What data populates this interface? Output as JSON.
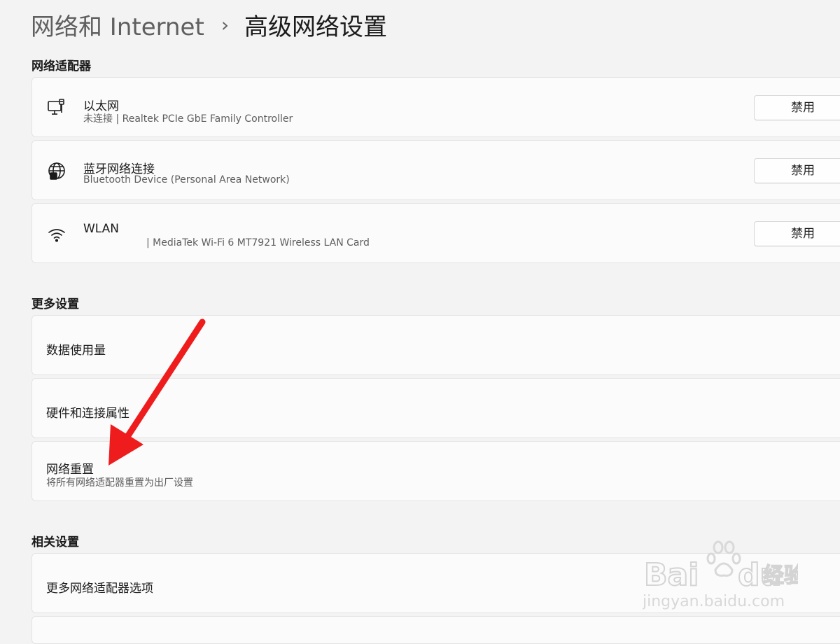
{
  "breadcrumb": {
    "parent": "网络和 Internet",
    "separator": "›",
    "current": "高级网络设置"
  },
  "sections": {
    "adapters": "网络适配器",
    "more": "更多设置",
    "related": "相关设置"
  },
  "adapters": [
    {
      "icon": "ethernet-monitor-icon",
      "name": "以太网",
      "detail": "未连接 | Realtek PCIe GbE Family Controller",
      "button": "禁用"
    },
    {
      "icon": "bluetooth-network-globe-icon",
      "name": "蓝牙网络连接",
      "detail": "Bluetooth Device (Personal Area Network)",
      "button": "禁用"
    },
    {
      "icon": "wifi-icon",
      "name": "WLAN",
      "detail": "| MediaTek Wi-Fi 6 MT7921 Wireless LAN Card",
      "button": "禁用"
    }
  ],
  "more_settings": [
    {
      "title": "数据使用量"
    },
    {
      "title": "硬件和连接属性"
    },
    {
      "title": "网络重置",
      "subtitle": "将所有网络适配器重置为出厂设置"
    }
  ],
  "related_settings": [
    {
      "title": "更多网络适配器选项"
    }
  ],
  "annotation": {
    "color": "#ee1c1c"
  },
  "watermark": {
    "brand_left": "Bai",
    "brand_right": "du",
    "brand_cn": "经验",
    "url": "jingyan.baidu.com"
  }
}
